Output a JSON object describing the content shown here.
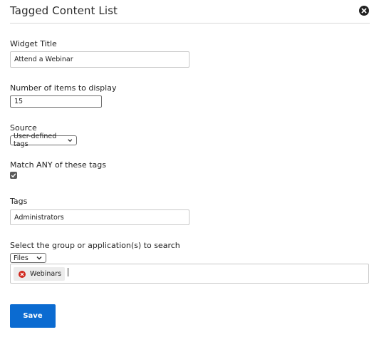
{
  "dialog": {
    "title": "Tagged Content List",
    "close_icon": "close-circle-icon"
  },
  "fields": {
    "widget_title": {
      "label": "Widget Title",
      "value": "Attend a Webinar"
    },
    "num_items": {
      "label": "Number of items to display",
      "value": "15"
    },
    "source": {
      "label": "Source",
      "selected": "User-defined tags"
    },
    "match_any": {
      "label": "Match ANY of these tags",
      "checked": true
    },
    "tags": {
      "label": "Tags",
      "value": "Administrators"
    },
    "search_scope": {
      "label": "Select the group or application(s) to search",
      "selected": "Files",
      "chips": [
        {
          "label": "Webinars",
          "remove_icon": "remove-circle-icon"
        }
      ]
    }
  },
  "actions": {
    "save_label": "Save"
  },
  "colors": {
    "primary_button": "#0b6bd1",
    "chip_remove": "#d0271d",
    "divider": "#d9d9d9"
  }
}
